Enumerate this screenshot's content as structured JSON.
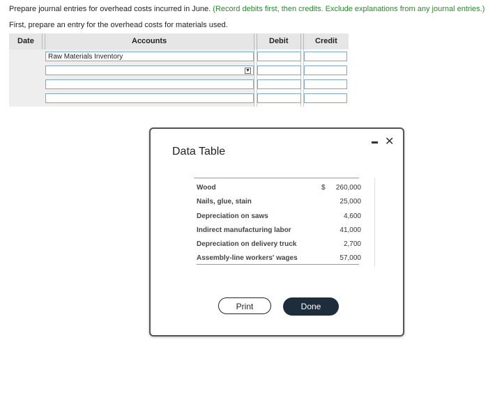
{
  "instructions": {
    "main": "Prepare journal entries for overhead costs incurred in June.",
    "note": "(Record debits first, then credits. Exclude explanations from any journal entries.)",
    "sub": "First, prepare an entry for the overhead costs for materials used."
  },
  "journal": {
    "headers": {
      "date": "Date",
      "accounts": "Accounts",
      "debit": "Debit",
      "credit": "Credit"
    },
    "rows": [
      {
        "account": "Raw Materials Inventory",
        "debit": "",
        "credit": ""
      },
      {
        "account": "",
        "debit": "",
        "credit": ""
      },
      {
        "account": "",
        "debit": "",
        "credit": ""
      },
      {
        "account": "",
        "debit": "",
        "credit": ""
      }
    ]
  },
  "modal": {
    "title": "Data Table",
    "currency": "$",
    "items": [
      {
        "label": "Wood",
        "value": "260,000"
      },
      {
        "label": "Nails, glue, stain",
        "value": "25,000"
      },
      {
        "label": "Depreciation on saws",
        "value": "4,600"
      },
      {
        "label": "Indirect manufacturing labor",
        "value": "41,000"
      },
      {
        "label": "Depreciation on delivery truck",
        "value": "2,700"
      },
      {
        "label": "Assembly-line workers' wages",
        "value": "57,000"
      }
    ],
    "print_label": "Print",
    "done_label": "Done",
    "close_glyph": "✕"
  },
  "colors": {
    "accent_green": "#2a8a2a",
    "done_button": "#1e2d3b",
    "field_border": "#7fa7c9"
  }
}
